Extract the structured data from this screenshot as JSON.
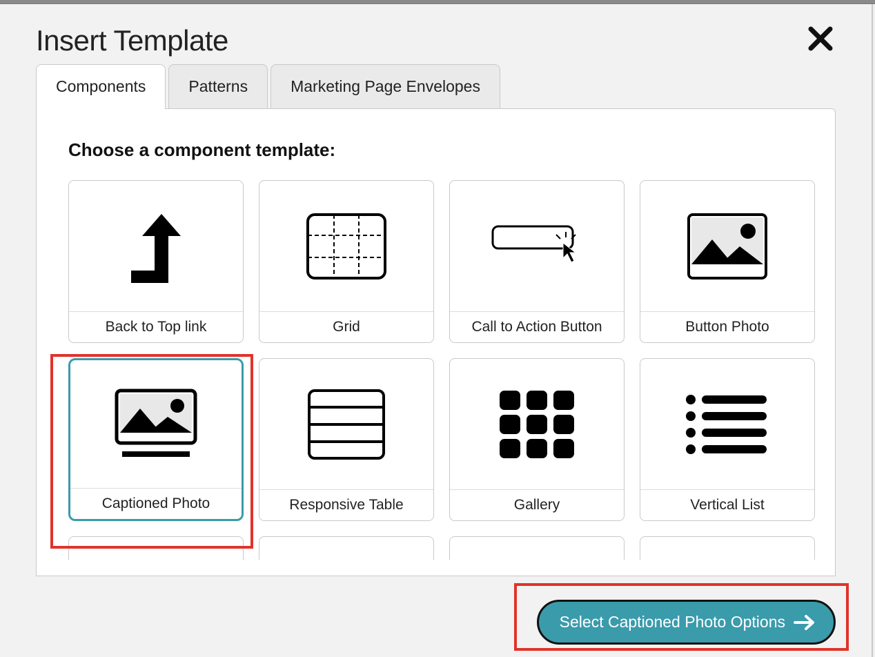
{
  "dialog": {
    "title": "Insert Template"
  },
  "tabs": {
    "items": [
      {
        "label": "Components",
        "active": true
      },
      {
        "label": "Patterns",
        "active": false
      },
      {
        "label": "Marketing Page Envelopes",
        "active": false
      }
    ]
  },
  "panel": {
    "heading": "Choose a component template:"
  },
  "cards": [
    {
      "label": "Back to Top link",
      "icon": "back-to-top",
      "selected": false
    },
    {
      "label": "Grid",
      "icon": "grid-lines",
      "selected": false
    },
    {
      "label": "Call to Action Button",
      "icon": "cta-button",
      "selected": false
    },
    {
      "label": "Button Photo",
      "icon": "photo",
      "selected": false
    },
    {
      "label": "Captioned Photo",
      "icon": "captioned-photo",
      "selected": true
    },
    {
      "label": "Responsive Table",
      "icon": "table-rows",
      "selected": false
    },
    {
      "label": "Gallery",
      "icon": "gallery-grid",
      "selected": false
    },
    {
      "label": "Vertical List",
      "icon": "vertical-list",
      "selected": false
    }
  ],
  "action": {
    "label": "Select Captioned Photo Options"
  },
  "colors": {
    "accent": "#3a9bab",
    "highlight": "#e0332a"
  }
}
